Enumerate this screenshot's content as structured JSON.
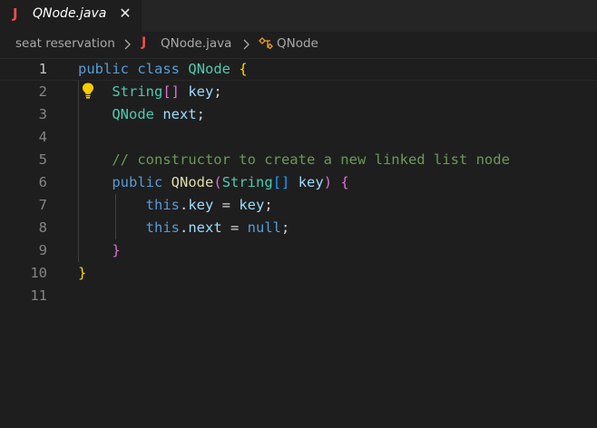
{
  "tab": {
    "java_icon": "J",
    "label": "QNode.java",
    "close": "✕"
  },
  "breadcrumb": {
    "folder": "seat reservation",
    "file_icon": "J",
    "file": "QNode.java",
    "symbol": "QNode"
  },
  "editor": {
    "line_numbers": [
      "1",
      "2",
      "3",
      "4",
      "5",
      "6",
      "7",
      "8",
      "9",
      "10",
      "11"
    ],
    "lines": {
      "l1": {
        "kw1": "public",
        "kw2": "class",
        "cls": "QNode",
        "brace": "{"
      },
      "l2": {
        "type": "String",
        "brackets": "[]",
        "name": "key",
        "semi": ";"
      },
      "l3": {
        "type": "QNode",
        "name": "next",
        "semi": ";"
      },
      "l5": {
        "comment": "// constructor to create a new linked list node"
      },
      "l6": {
        "kw": "public",
        "fn": "QNode",
        "open": "(",
        "type": "String",
        "brackets": "[]",
        "param": "key",
        "close": ")",
        "brace": "{"
      },
      "l7": {
        "this": "this",
        "dot": ".",
        "field": "key",
        "eq": " = ",
        "val": "key",
        "semi": ";"
      },
      "l8": {
        "this": "this",
        "dot": ".",
        "field": "next",
        "eq": " = ",
        "val": "null",
        "semi": ";"
      },
      "l9": {
        "brace": "}"
      },
      "l10": {
        "brace": "}"
      }
    }
  },
  "colors": {
    "background": "#1e1e1e",
    "keyword": "#569cd6",
    "type": "#4ec9b0",
    "variable": "#9cdcfe",
    "function": "#dcdcaa",
    "comment": "#6a9955",
    "bracket_level1": "#ffd700",
    "bracket_level2": "#da70d6",
    "bracket_level3": "#179fff",
    "java_icon": "#f14c4c"
  },
  "icons": [
    "java-icon",
    "close-icon",
    "chevron-right-icon",
    "class-symbol-icon",
    "lightbulb-icon"
  ]
}
